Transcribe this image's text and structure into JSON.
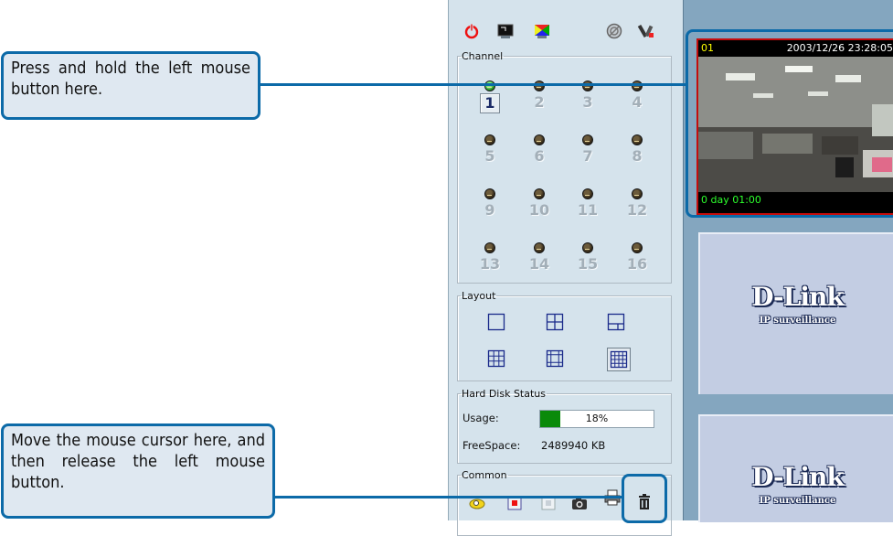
{
  "callouts": {
    "press": "Press and hold the left mouse button here.",
    "release": "Move the mouse cursor here, and then release the left mouse button."
  },
  "toolbar": {
    "icons": [
      "power-icon",
      "fullscreen-icon",
      "color-icon",
      "record-icon",
      "settings-icon"
    ]
  },
  "channel": {
    "legend": "Channel",
    "numbers": [
      "1",
      "2",
      "3",
      "4",
      "5",
      "6",
      "7",
      "8",
      "9",
      "10",
      "11",
      "12",
      "13",
      "14",
      "15",
      "16"
    ],
    "active": "1"
  },
  "layout": {
    "legend": "Layout"
  },
  "disk": {
    "legend": "Hard Disk Status",
    "usage_label": "Usage:",
    "usage_value": "18%",
    "usage_fraction": 0.18,
    "free_label": "FreeSpace:",
    "free_value": "2489940 KB"
  },
  "common": {
    "legend": "Common",
    "icons": [
      "snapshot-search-icon",
      "record-stop-icon",
      "stop-icon",
      "camera-icon",
      "print-icon",
      "trash-icon"
    ]
  },
  "camera1": {
    "channel": "01",
    "timestamp": "2003/12/26 23:28:05",
    "uptime": "0 day 01:00"
  },
  "branding": {
    "logo": "D-Link",
    "tagline": "IP surveillance"
  },
  "colors": {
    "accent": "#0c6aa8",
    "panel": "#d5e3ec",
    "active_border": "#c40d0d",
    "usage_bar": "#0a8a0a"
  }
}
